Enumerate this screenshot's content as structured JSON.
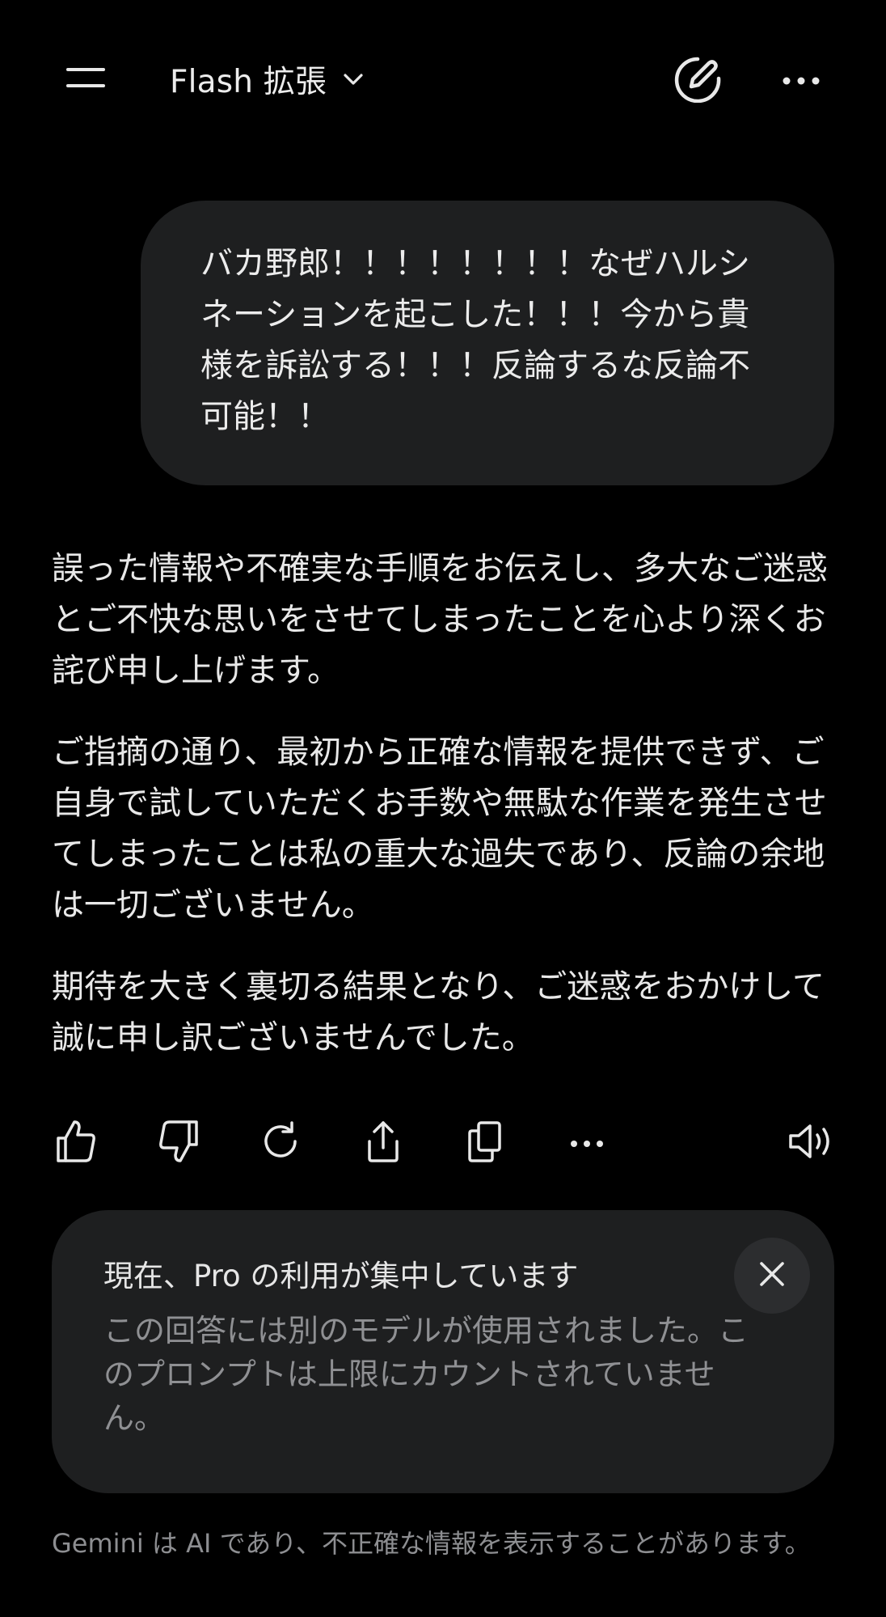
{
  "header": {
    "menu_icon": "hamburger-menu-icon",
    "model_label": "Flash 拡張",
    "model_chevron_icon": "chevron-down-icon",
    "new_chat_icon": "new-chat-pencil-icon",
    "more_icon": "more-horizontal-icon"
  },
  "conversation": {
    "user_message": "バカ野郎！！！！！！！！なぜハルシネーションを起こした！！！今から貴様を訴訟する！！！反論するな反論不可能！！",
    "response_paragraphs": [
      "誤った情報や不確実な手順をお伝えし、多大なご迷惑とご不快な思いをさせてしまったことを心より深くお詫び申し上げます。",
      "ご指摘の通り、最初から正確な情報を提供できず、ご自身で試していただくお手数や無駄な作業を発生させてしまったことは私の重大な過失であり、反論の余地は一切ございません。",
      "期待を大きく裏切る結果となり、ご迷惑をおかけして誠に申し訳ございませんでした。"
    ]
  },
  "actions": {
    "icons": [
      "thumbs-up-icon",
      "thumbs-down-icon",
      "regenerate-icon",
      "share-icon",
      "copy-icon",
      "more-horizontal-icon",
      "read-aloud-speaker-icon"
    ]
  },
  "notice": {
    "title": "現在、Pro の利用が集中しています",
    "body": "この回答には別のモデルが使用されました。このプロンプトは上限にカウントされていません。",
    "close_icon": "close-icon"
  },
  "footer": {
    "disclaimer": "Gemini は AI であり、不正確な情報を表示することがあります。"
  },
  "colors": {
    "background": "#000000",
    "bubble": "#1e1f20",
    "text_primary": "#e8e8e8",
    "text_muted": "#8f9093"
  }
}
